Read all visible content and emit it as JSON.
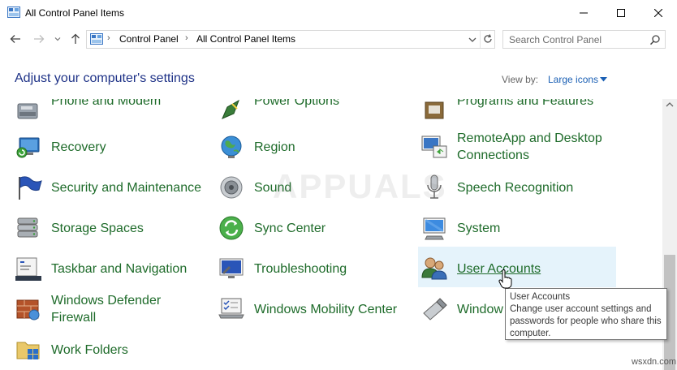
{
  "window": {
    "title": "All Control Panel Items"
  },
  "address": {
    "crumbs": [
      "Control Panel",
      "All Control Panel Items"
    ],
    "search_placeholder": "Search Control Panel"
  },
  "header": {
    "title": "Adjust your computer's settings",
    "view_by_label": "View by:",
    "view_by_value": "Large icons"
  },
  "items": {
    "col1": [
      {
        "label": "Phone and Modem",
        "icon": "phone-modem-icon"
      },
      {
        "label": "Recovery",
        "icon": "recovery-icon"
      },
      {
        "label": "Security and Maintenance",
        "icon": "security-flag-icon"
      },
      {
        "label": "Storage Spaces",
        "icon": "storage-spaces-icon"
      },
      {
        "label": "Taskbar and Navigation",
        "icon": "taskbar-icon"
      },
      {
        "label": "Windows Defender",
        "label2": "Firewall",
        "icon": "firewall-icon"
      },
      {
        "label": "Work Folders",
        "icon": "work-folders-icon"
      }
    ],
    "col2": [
      {
        "label": "Power Options",
        "icon": "power-options-icon"
      },
      {
        "label": "Region",
        "icon": "region-globe-icon"
      },
      {
        "label": "Sound",
        "icon": "speaker-icon"
      },
      {
        "label": "Sync Center",
        "icon": "sync-center-icon"
      },
      {
        "label": "Troubleshooting",
        "icon": "troubleshooting-icon"
      },
      {
        "label": "Windows Mobility Center",
        "icon": "mobility-center-icon"
      }
    ],
    "col3": [
      {
        "label": "Programs and Features",
        "icon": "programs-features-icon"
      },
      {
        "label": "RemoteApp and Desktop",
        "label2": "Connections",
        "icon": "remoteapp-icon"
      },
      {
        "label": "Speech Recognition",
        "icon": "microphone-icon"
      },
      {
        "label": "System",
        "icon": "system-monitor-icon"
      },
      {
        "label": "User Accounts",
        "icon": "user-accounts-icon"
      },
      {
        "label": "Window",
        "icon": "usb-drive-icon"
      }
    ]
  },
  "tooltip": {
    "title": "User Accounts",
    "body": "Change user account settings and passwords for people who share this computer."
  },
  "watermark": {
    "text": "APPUALS",
    "site": "wsxdn.com"
  },
  "colors": {
    "link_green": "#1e6b2a",
    "heading_blue": "#1e3287",
    "hover_bg": "#e5f3fb",
    "accent": "#1a5fb4"
  }
}
